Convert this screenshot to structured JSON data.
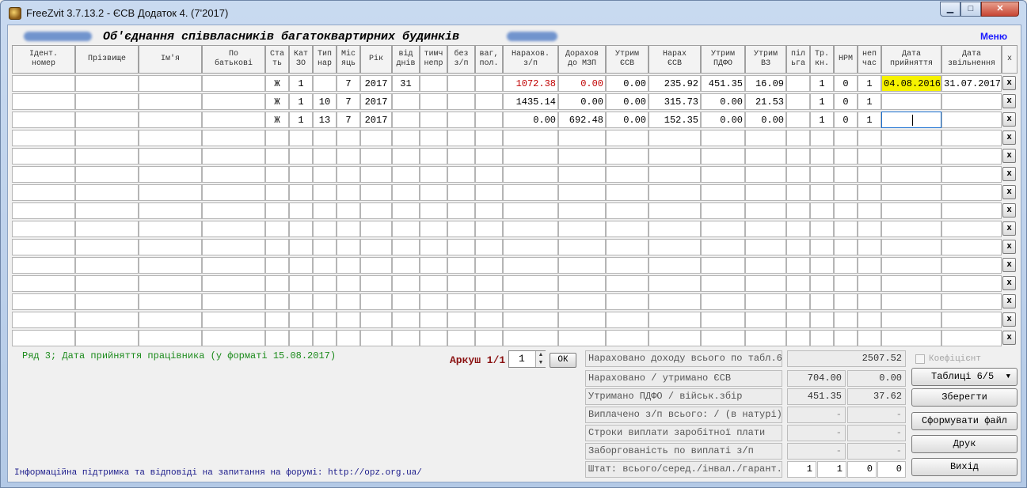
{
  "window": {
    "title": "FreeZvit 3.7.13.2 - ЄСВ Додаток 4. (7'2017)",
    "minimize": "▁",
    "maximize": "□",
    "close": "✕"
  },
  "header": {
    "org_title": "Об'єднання співвласників багатоквартирних будинків",
    "menu": "Меню"
  },
  "columns": [
    "Ідент.\nномер",
    "Прізвище",
    "Ім'я",
    "По\nбатькові",
    "Ста\nть",
    "Кат\nЗО",
    "Тип\nнар",
    "Міс\nяць",
    "Рік",
    "від\nднів",
    "тимч\nнепр",
    "без\nз/п",
    "ваг,\nпол.",
    "Нарахов.\nз/п",
    "Дорахов\nдо МЗП",
    "Утрим\nЄСВ",
    "Нарах\nЄСВ",
    "Утрим\nПДФО",
    "Утрим\nВЗ",
    "піл\nьга",
    "Тр.\nкн.",
    "НРМ",
    "неп\nчас",
    "Дата\nприйняття",
    "Дата\nзвільнення",
    "x"
  ],
  "rows": [
    [
      "",
      "",
      "",
      "",
      "Ж",
      "1",
      "",
      "7",
      "2017",
      "31",
      "",
      "",
      "",
      "1072.38",
      "0.00",
      "0.00",
      "235.92",
      "451.35",
      "16.09",
      "",
      "1",
      "0",
      "1",
      "04.08.2016",
      "31.07.2017"
    ],
    [
      "",
      "",
      "",
      "",
      "Ж",
      "1",
      "10",
      "7",
      "2017",
      "",
      "",
      "",
      "",
      "1435.14",
      "0.00",
      "0.00",
      "315.73",
      "0.00",
      "21.53",
      "",
      "1",
      "0",
      "1",
      "",
      ""
    ],
    [
      "",
      "",
      "",
      "",
      "Ж",
      "1",
      "13",
      "7",
      "2017",
      "",
      "",
      "",
      "",
      "0.00",
      "692.48",
      "0.00",
      "152.35",
      "0.00",
      "0.00",
      "",
      "1",
      "0",
      "1",
      "",
      ""
    ]
  ],
  "delete_label": "x",
  "hint": "Ряд 3; Дата прийняття працівника (у форматі 15.08.2017)",
  "footer": "Інформаційна підтримка та відповіді на запитання на форумі: http://opz.org.ua/",
  "sheet": {
    "label": "Аркуш 1/1",
    "value": "1",
    "ok": "ОК"
  },
  "summary": {
    "income_label": "Нараховано доходу всього по табл.6",
    "income_value": "2507.52",
    "esv_label": "Нараховано / утримано ЄСВ",
    "esv_accrued": "704.00",
    "esv_withheld": "0.00",
    "pdfo_label": "Утримано ПДФО / військ.збір",
    "pdfo_value": "451.35",
    "military_value": "37.62",
    "paid_label": "Виплачено з/п всього: / (в натурі)",
    "paid_value": "-",
    "paid_kind": "-",
    "terms_label": "Строки виплати заробітної плати",
    "terms_a": "-",
    "terms_b": "-",
    "debt_label": "Заборгованість по виплаті з/п",
    "debt_a": "-",
    "debt_b": "-",
    "staff_label": "Штат: всього/серед./інвал./гарант.",
    "staff_total": "1",
    "staff_avg": "1",
    "staff_disabled": "0",
    "staff_guaranteed": "0"
  },
  "side": {
    "coefficient": "Коефіцієнт",
    "tables": "Таблиці 6/5",
    "save": "Зберегти",
    "form_file": "Сформувати файл",
    "print": "Друк",
    "exit": "Вихід"
  }
}
